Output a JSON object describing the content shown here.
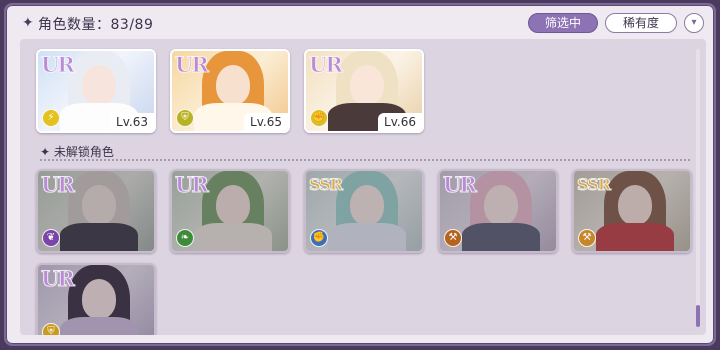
{
  "header": {
    "title_label": "角色数量：83/89",
    "filter_label": "筛选中",
    "rarity_label": "稀有度",
    "dropdown_glyph": "▾"
  },
  "owned": [
    {
      "rank": "UR",
      "level": "Lv.63",
      "element_icon": "lightning-icon",
      "element_color": "#e3c21f"
    },
    {
      "rank": "UR",
      "level": "Lv.65",
      "element_icon": "shield-icon",
      "element_color": "#b9b223"
    },
    {
      "rank": "UR",
      "level": "Lv.66",
      "element_icon": "fist-icon",
      "element_color": "#d9bd2a"
    }
  ],
  "locked_section_label": "未解锁角色",
  "locked": [
    {
      "rank": "UR",
      "element_icon": "feather-icon",
      "element_color": "#7a45a6"
    },
    {
      "rank": "UR",
      "element_icon": "leaf-icon",
      "element_color": "#3e8c3a"
    },
    {
      "rank": "SSR",
      "element_icon": "fist-icon",
      "element_color": "#3c6fb8"
    },
    {
      "rank": "UR",
      "element_icon": "hammer-icon",
      "element_color": "#b5641f"
    },
    {
      "rank": "SSR",
      "element_icon": "hammer-icon",
      "element_color": "#c8862a"
    },
    {
      "rank": "UR",
      "element_icon": "shield-icon",
      "element_color": "#c89a22"
    }
  ]
}
